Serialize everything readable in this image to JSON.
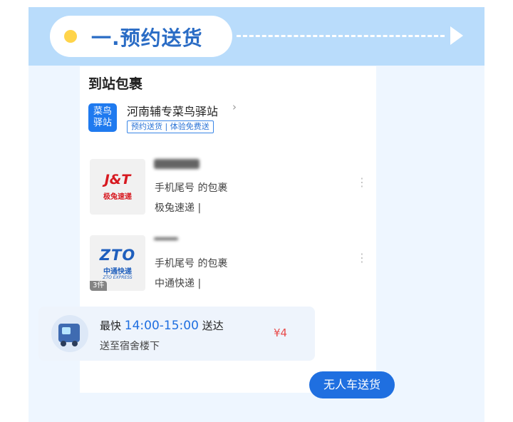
{
  "section": {
    "title": "一.预约送货"
  },
  "card": {
    "title": "到站包裹",
    "station": {
      "logo_text": "菜鸟\n驿站",
      "name": "河南辅专菜鸟驿站",
      "tag": "预约送货 | 体验免费送"
    },
    "packages": [
      {
        "courier_logo": "J&T",
        "courier_logo_cn": "极兔速递",
        "line1": "手机尾号        的包裹",
        "line2": "极兔速递 |",
        "count": ""
      },
      {
        "courier_logo": "ZTO",
        "courier_logo_cn": "中通快递",
        "courier_logo_en": "ZTO EXPRESS",
        "line1": "手机尾号        的包裹",
        "line2": "中通快递 |",
        "count": "3件"
      }
    ],
    "delivery": {
      "prefix": "最快",
      "time": "14:00-15:00",
      "suffix": "送达",
      "destination": "送至宿舍楼下",
      "price": "¥4"
    },
    "button": "无人车送货"
  },
  "icons": {
    "more": "more-vertical-icon",
    "chevron": "chevron-right-icon",
    "robot": "delivery-robot-icon"
  },
  "colors": {
    "brand_blue": "#1f6fe0",
    "price_red": "#e84b4b",
    "banner": "#b9dcfb"
  }
}
